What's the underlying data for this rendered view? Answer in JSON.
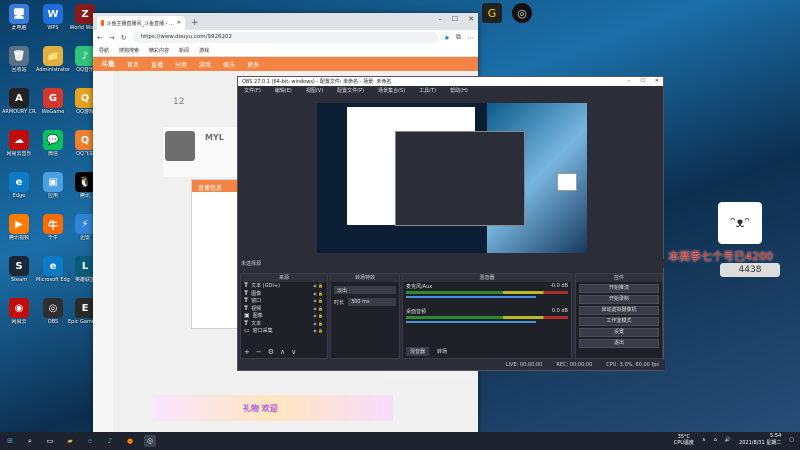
{
  "desktop": {
    "icons": [
      {
        "label": "此电脑",
        "glyph": "🖥",
        "color": "#3a7bd5"
      },
      {
        "label": "WPS",
        "glyph": "W",
        "color": "#1e6fd9"
      },
      {
        "label": "World War Z",
        "glyph": "Z",
        "color": "#8b1a1a"
      },
      {
        "label": "回收站",
        "glyph": "🗑",
        "color": "#5a7088"
      },
      {
        "label": "Administrator",
        "glyph": "📁",
        "color": "#e0b040"
      },
      {
        "label": "QQ音乐",
        "glyph": "♪",
        "color": "#31c27c"
      },
      {
        "label": "ARMOURY CRATE",
        "glyph": "A",
        "color": "#222"
      },
      {
        "label": "WeGame",
        "glyph": "G",
        "color": "#d4382c"
      },
      {
        "label": "QQ游戏",
        "glyph": "Q",
        "color": "#e8a020"
      },
      {
        "label": "网易云音乐",
        "glyph": "☁",
        "color": "#c20c0c"
      },
      {
        "label": "微信",
        "glyph": "💬",
        "color": "#07c160"
      },
      {
        "label": "QQ飞车",
        "glyph": "Q",
        "color": "#f08030"
      },
      {
        "label": "Edge",
        "glyph": "e",
        "color": "#0a7bc4"
      },
      {
        "label": "应用",
        "glyph": "▣",
        "color": "#4aa0e0"
      },
      {
        "label": "腾讯",
        "glyph": "🐧",
        "color": "#000"
      },
      {
        "label": "腾讯视频",
        "glyph": "▶",
        "color": "#ff7a00"
      },
      {
        "label": "千牛",
        "glyph": "牛",
        "color": "#ff6a00"
      },
      {
        "label": "迅雷",
        "glyph": "⚡",
        "color": "#2f84d8"
      },
      {
        "label": "Steam",
        "glyph": "S",
        "color": "#1b2838"
      },
      {
        "label": "Microsoft Edge",
        "glyph": "e",
        "color": "#0a7bc4"
      },
      {
        "label": "英雄联盟",
        "glyph": "L",
        "color": "#0a5a78"
      },
      {
        "label": "网易云",
        "glyph": "◉",
        "color": "#c20c0c"
      },
      {
        "label": "OBS",
        "glyph": "◎",
        "color": "#302e31"
      },
      {
        "label": "Epic Games Launcher",
        "glyph": "E",
        "color": "#2a2a2a"
      }
    ]
  },
  "browser": {
    "tab_title": "斗鱼主播直播间_斗鱼直播 - ...",
    "url": "https://www.douyu.com/9926202",
    "bookmarks": [
      "导航",
      "搜狗搜索",
      "精彩内容",
      "新闻",
      "游戏"
    ],
    "site_nav": [
      "斗鱼",
      "首页",
      "直播",
      "分类",
      "游戏",
      "娱乐",
      "更多"
    ],
    "profile_name": "MYL",
    "room_num": "12",
    "modal_title": "直播信息",
    "banner_text": "礼物 欢迎"
  },
  "obs": {
    "title": "OBS 27.0.1 (64-bit, windows) - 配置文件: 未命名 - 场景: 未命名",
    "menu": [
      "文件(F)",
      "编辑(E)",
      "视图(V)",
      "配置文件(P)",
      "场景集合(S)",
      "工具(T)",
      "帮助(H)"
    ],
    "status_left": "未选择源",
    "docks": {
      "scenes": "来源",
      "transitions": "转场特效",
      "mixer": "混音器",
      "controls": "控件"
    },
    "sources": [
      "文本 (GDI+)",
      "图像",
      "窗口",
      "视频",
      "图像",
      "文本",
      "窗口采集"
    ],
    "transition_value": "淡出",
    "duration_label": "时长",
    "duration_value": "300 ms",
    "mixer_tracks": [
      {
        "name": "麦克风/Aux",
        "db": "-0.0 dB"
      },
      {
        "name": "桌面音频",
        "db": "0.0 dB"
      }
    ],
    "mixer_tabs": [
      "混音器",
      "转场"
    ],
    "controls": [
      "开始推流",
      "开始录制",
      "启动虚拟摄像机",
      "工作室模式",
      "设置",
      "退出"
    ],
    "statusbar": [
      "LIVE: 00:00:00",
      "REC: 00:00:00",
      "CPU: 3.0%, 60.00 fps"
    ]
  },
  "overlay": {
    "text": "本赛季七个号已4200",
    "sub": "4438"
  },
  "taskbar": {
    "temp": "35°C",
    "cpu": "CPU温度",
    "time": "5:54",
    "date": "2021/8/31 星期二"
  }
}
